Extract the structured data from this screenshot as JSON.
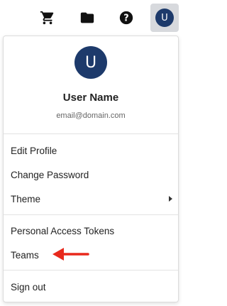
{
  "topbar": {
    "icons": [
      "cart-icon",
      "folder-icon",
      "help-icon"
    ],
    "avatar_initial": "U",
    "avatar_color": "#1d3a6b"
  },
  "profile": {
    "avatar_initial": "U",
    "name": "User Name",
    "email": "email@domain.com"
  },
  "menu": {
    "edit_profile": "Edit Profile",
    "change_password": "Change Password",
    "theme": "Theme",
    "personal_access_tokens": "Personal Access Tokens",
    "teams": "Teams",
    "sign_out": "Sign out"
  },
  "annotation": {
    "arrow_color": "#e8291c"
  }
}
